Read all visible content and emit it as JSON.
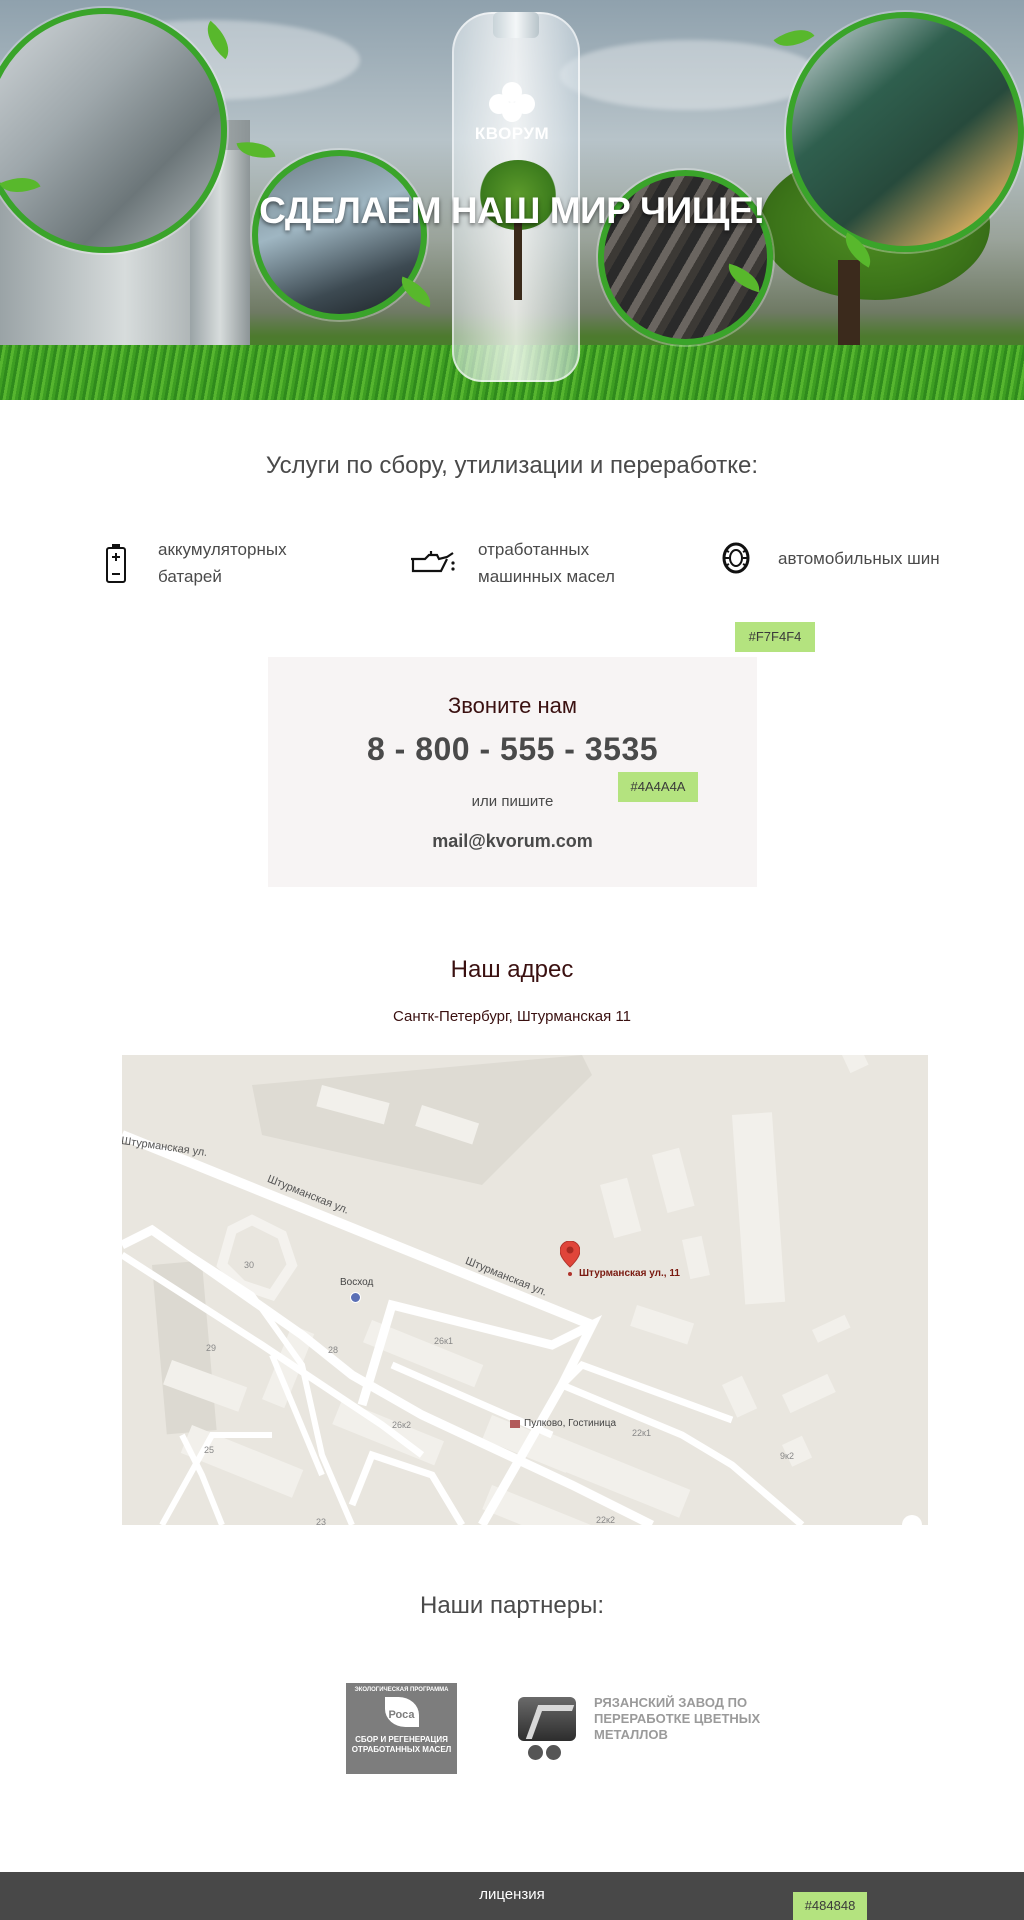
{
  "colors": {
    "contact_bg": "#F7F4F4",
    "text_main": "#4A4A4A",
    "footer_bg": "#484848",
    "tag_bg": "#b4e37f",
    "accent_green": "#3aa42a",
    "map_pin": "#e0453a"
  },
  "hero": {
    "logo_text": "КВОРУМ",
    "title": "СДЕЛАЕМ НАШ МИР ЧИЩЕ!"
  },
  "services": {
    "title": "Услуги по сбору, утилизации и переработке:",
    "items": [
      {
        "icon": "battery-icon",
        "label_line1": "аккумуляторных",
        "label_line2": "батарей"
      },
      {
        "icon": "oil-can-icon",
        "label_line1": "отработанных",
        "label_line2": "машинных масел"
      },
      {
        "icon": "tire-icon",
        "label_line1": "автомобильных шин",
        "label_line2": ""
      }
    ]
  },
  "color_tags": {
    "contact_bg": "#F7F4F4",
    "text_color": "#4A4A4A",
    "footer_color": "#484848"
  },
  "contact": {
    "call_label": "Звоните нам",
    "phone": "8 - 800 - 555 - 3535",
    "or_write": "или пишите",
    "email": "mail@kvorum.com"
  },
  "address": {
    "title": "Наш адрес",
    "text": "Сантк-Петербург, Штурманская 11"
  },
  "map": {
    "streets": [
      "Штурманская ул.",
      "Штурманская ул.",
      "Штурманская ул."
    ],
    "pin_label": "Штурманская ул., 11",
    "poi_voskhod": "Восход",
    "poi_hotel": "Пулково, Гостиница",
    "buildings": [
      "30",
      "29",
      "28",
      "26к1",
      "26к2",
      "25",
      "22к1",
      "9к2",
      "22к2",
      "23"
    ]
  },
  "partners": {
    "title": "Наши партнеры:",
    "rosa": {
      "top_text": "ЭКОЛОГИЧЕСКАЯ ПРОГРАММА",
      "name": "Роса",
      "bottom_line1": "СБОР И РЕГЕНЕРАЦИЯ",
      "bottom_line2": "ОТРАБОТАННЫХ МАСЕЛ"
    },
    "ryazan": {
      "line1": "РЯЗАНСКИЙ ЗАВОД ПО",
      "line2": "ПЕРЕРАБОТКЕ ЦВЕТНЫХ",
      "line3": "МЕТАЛЛОВ"
    }
  },
  "footer": {
    "license": "лицензия"
  }
}
